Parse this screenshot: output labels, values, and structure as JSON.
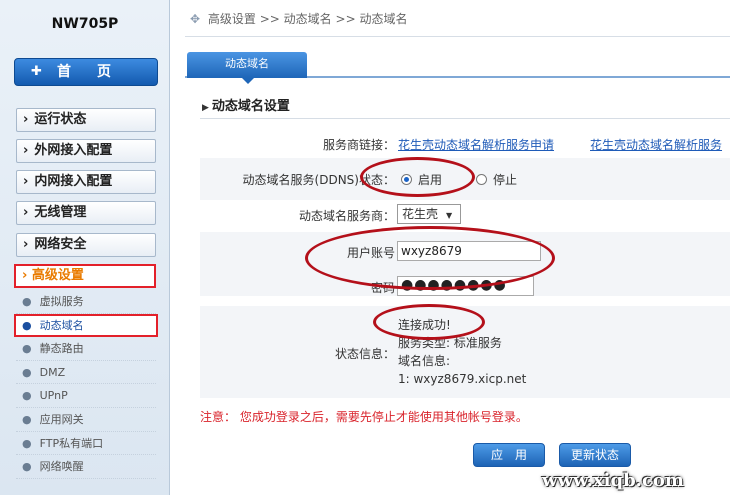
{
  "sidebar": {
    "model": "NW705P",
    "home": "首　页",
    "menu": [
      "运行状态",
      "外网接入配置",
      "内网接入配置",
      "无线管理",
      "网络安全"
    ],
    "advanced": "高级设置",
    "submenu": [
      "虚拟服务",
      "动态域名",
      "静态路由",
      "DMZ",
      "UPnP",
      "应用网关",
      "FTP私有端口",
      "网络唤醒"
    ],
    "active_submenu": "动态域名"
  },
  "breadcrumb": {
    "parts": [
      "高级设置",
      ">>",
      "动态域名",
      ">>",
      "动态域名"
    ]
  },
  "tab": {
    "label": "动态域名"
  },
  "section": {
    "title": "动态域名设置"
  },
  "form": {
    "provider_link_label": "服务商链接：",
    "provider_link_1": "花生壳动态域名解析服务申请",
    "provider_link_2": "花生壳动态域名解析服务",
    "ddns_label": "动态域名服务(DDNS)状态：",
    "ddns_on": "启用",
    "ddns_off": "停止",
    "ddns_state": "启用",
    "provider_label": "动态域名服务商：",
    "provider_value": "花生壳",
    "account_label": "用户账号",
    "account_value": "wxyz8679",
    "password_label": "密码",
    "password_value": "●●●●●●●●",
    "status_label": "状态信息：",
    "status_lines": [
      "连接成功!",
      "服务类型: 标准服务",
      "域名信息:",
      "1: wxyz8679.xicp.net"
    ]
  },
  "notice": "注意： 您成功登录之后，需要先停止才能使用其他帐号登录。",
  "buttons": {
    "apply": "应　用",
    "refresh": "更新状态"
  },
  "watermark": "www.xiqb.com",
  "colors": {
    "highlight_red": "#e3202a",
    "ellipse": "#b4101a",
    "accent_blue": "#1e66b8"
  }
}
